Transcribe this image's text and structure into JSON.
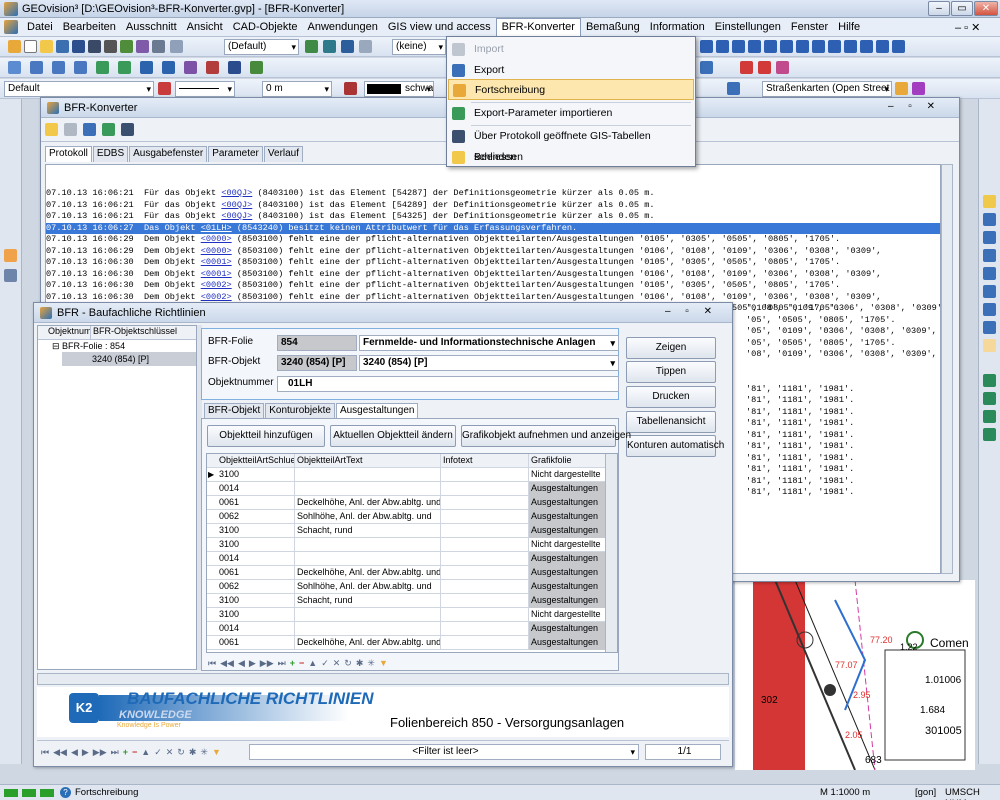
{
  "app": {
    "title": "GEOvision³ [D:\\GEOvision³-BFR-Konverter.gvp] - [BFR-Konverter]"
  },
  "menu": [
    "Datei",
    "Bearbeiten",
    "Ausschnitt",
    "Ansicht",
    "CAD-Objekte",
    "Anwendungen",
    "GIS view und access",
    "BFR-Konverter",
    "Bemaßung",
    "Information",
    "Einstellungen",
    "Fenster",
    "Hilfe"
  ],
  "toolbar": {
    "combo_default": "(Default)",
    "combo_keine": "(keine)",
    "layer_combo": "Default",
    "width_value": "0 m",
    "color_name": "schwarz",
    "map_source": "Straßenkarten (Open Street M"
  },
  "dropdown": {
    "items": [
      "Import",
      "Export",
      "Fortschreibung",
      "Export-Parameter importieren",
      "Über Protokoll geöffnete GIS-Tabellen schliessen",
      "Beenden"
    ]
  },
  "konverter": {
    "title": "BFR-Konverter",
    "tabs": [
      "Protokoll",
      "EDBS",
      "Ausgabefenster",
      "Parameter",
      "Verlauf"
    ],
    "log": [
      {
        "pre": "07.10.13 16:06:21  Für das Objekt ",
        "link": "<00QJ>",
        "post": " (8403100) ist das Element [54287] der Definitionsgeometrie kürzer als 0.05 m."
      },
      {
        "pre": "07.10.13 16:06:21  Für das Objekt ",
        "link": "<00QJ>",
        "post": " (8403100) ist das Element [54289] der Definitionsgeometrie kürzer als 0.05 m."
      },
      {
        "pre": "07.10.13 16:06:21  Für das Objekt ",
        "link": "<00QJ>",
        "post": " (8403100) ist das Element [54325] der Definitionsgeometrie kürzer als 0.05 m."
      },
      {
        "pre": "07.10.13 16:06:27  Das Objekt ",
        "link": "<01LH>",
        "post": " (8543240) besitzt keinen Attributwert für das Erfassungsverfahren.",
        "sel": true
      },
      {
        "pre": "07.10.13 16:06:29  Dem Objekt ",
        "link": "<0000>",
        "post": " (8503100) fehlt eine der pflicht-alternativen Objektteilarten/Ausgestaltungen '0105', '0305', '0505', '0805', '1705'."
      },
      {
        "pre": "07.10.13 16:06:29  Dem Objekt ",
        "link": "<0000>",
        "post": " (8503100) fehlt eine der pflicht-alternativen Objektteilarten/Ausgestaltungen '0106', '0108', '0109', '0306', '0308', '0309',"
      },
      {
        "pre": "07.10.13 16:06:30  Dem Objekt ",
        "link": "<0001>",
        "post": " (8503100) fehlt eine der pflicht-alternativen Objektteilarten/Ausgestaltungen '0105', '0305', '0505', '0805', '1705'."
      },
      {
        "pre": "07.10.13 16:06:30  Dem Objekt ",
        "link": "<0001>",
        "post": " (8503100) fehlt eine der pflicht-alternativen Objektteilarten/Ausgestaltungen '0106', '0108', '0109', '0306', '0308', '0309',"
      },
      {
        "pre": "07.10.13 16:06:30  Dem Objekt ",
        "link": "<0002>",
        "post": " (8503100) fehlt eine der pflicht-alternativen Objektteilarten/Ausgestaltungen '0105', '0305', '0505', '0805', '1705'."
      },
      {
        "pre": "07.10.13 16:06:30  Dem Objekt ",
        "link": "<0002>",
        "post": " (8503100) fehlt eine der pflicht-alternativen Objektteilarten/Ausgestaltungen '0106', '0108', '0109', '0306', '0308', '0309',"
      },
      {
        "pre": "07.10.13 16:06:30  Dem Objekt ",
        "link": "<0003>",
        "post": " (8503100) fehlt eine der pflicht-alternativen Objektteilarten/Ausgestaltungen '0105', '0305', '0505', '0805', '1705'."
      }
    ],
    "log_tail": [
      "'0108', '0109', '0306', '0308', '0309',",
      "'05', '0505', '0805', '1705'.",
      "'05', '0109', '0306', '0308', '0309',",
      "'05', '0505', '0805', '1705'.",
      "'08', '0109', '0306', '0308', '0309',",
      "",
      "",
      "'81', '1181', '1981'.",
      "'81', '1181', '1981'.",
      "'81', '1181', '1981'.",
      "'81', '1181', '1981'.",
      "'81', '1181', '1981'.",
      "'81', '1181', '1981'.",
      "'81', '1181', '1981'.",
      "'81', '1181', '1981'.",
      "'81', '1181', '1981'.",
      "'81', '1181', '1981'."
    ]
  },
  "richtlinien": {
    "title": "BFR - Baufachliche Richtlinien",
    "tree_headers": [
      "Objektnum",
      "BFR-Objektschlüssel"
    ],
    "tree_items": [
      "BFR-Folie : 854",
      "3240 (854) [P]"
    ],
    "folie_label": "BFR-Folie",
    "folie_num": "854",
    "folie_name": "Fernmelde- und Informationstechnische Anlagen",
    "objekt_label": "BFR-Objekt",
    "objekt_value": "3240 (854) [P]",
    "objekt_combo": "3240 (854) [P]",
    "objektnummer_label": "Objektnummer",
    "objektnummer_value": "01LH",
    "side_buttons": [
      "Zeigen",
      "Tippen",
      "Drucken",
      "Tabellenansicht",
      "Konturen automatisch"
    ],
    "tabs": [
      "BFR-Objekt",
      "Konturobjekte",
      "Ausgestaltungen"
    ],
    "action_buttons": [
      "Objektteil hinzufügen",
      "Aktuellen Objektteil ändern",
      "Grafikobjekt aufnehmen und anzeigen"
    ],
    "grid_headers": [
      "ObjektteilArtSchlues",
      "ObjektteilArtText",
      "Infotext",
      "Grafikfolie"
    ],
    "grid_rows": [
      [
        "3100",
        "",
        "",
        "Nicht dargestellte"
      ],
      [
        "0014",
        "",
        "",
        "Ausgestaltungen"
      ],
      [
        "0061",
        "Deckelhöhe, Anl. der Abw.abltg. und",
        "",
        "Ausgestaltungen"
      ],
      [
        "0062",
        "Sohlhöhe, Anl. der Abw.abltg. und",
        "",
        "Ausgestaltungen"
      ],
      [
        "3100",
        "Schacht, rund",
        "",
        "Ausgestaltungen"
      ],
      [
        "3100",
        "",
        "",
        "Nicht dargestellte"
      ],
      [
        "0014",
        "",
        "",
        "Ausgestaltungen"
      ],
      [
        "0061",
        "Deckelhöhe, Anl. der Abw.abltg. und",
        "",
        "Ausgestaltungen"
      ],
      [
        "0062",
        "Sohlhöhe, Anl. der Abw.abltg. und",
        "",
        "Ausgestaltungen"
      ],
      [
        "3100",
        "Schacht, rund",
        "",
        "Ausgestaltungen"
      ],
      [
        "3100",
        "",
        "",
        "Nicht dargestellte"
      ],
      [
        "0014",
        "",
        "",
        "Ausgestaltungen"
      ],
      [
        "0061",
        "Deckelhöhe, Anl. der Abw.abltg. und",
        "",
        "Ausgestaltungen"
      ]
    ],
    "banner_title": "BAUFACHLICHE RICHTLINIEN",
    "banner_k2": "K2",
    "banner_knowledge": "KNOWLEDGE",
    "banner_tagline": "Knowledge Is Power",
    "banner_folienbereich": "Folienbereich 850 - Versorgungsanlagen",
    "filter_text": "<Filter ist leer>",
    "record_pos": "1/1"
  },
  "map_labels": [
    "77.20",
    "1.22",
    "Comen",
    "1.01006",
    "1.684",
    "301005",
    "683",
    "77.07",
    "2.95",
    "2.05",
    "302"
  ],
  "statusbar": {
    "text": "Fortschreibung",
    "scale": "M 1:1000 m",
    "unit": "[gon]",
    "keys": "UMSCH NUM"
  }
}
